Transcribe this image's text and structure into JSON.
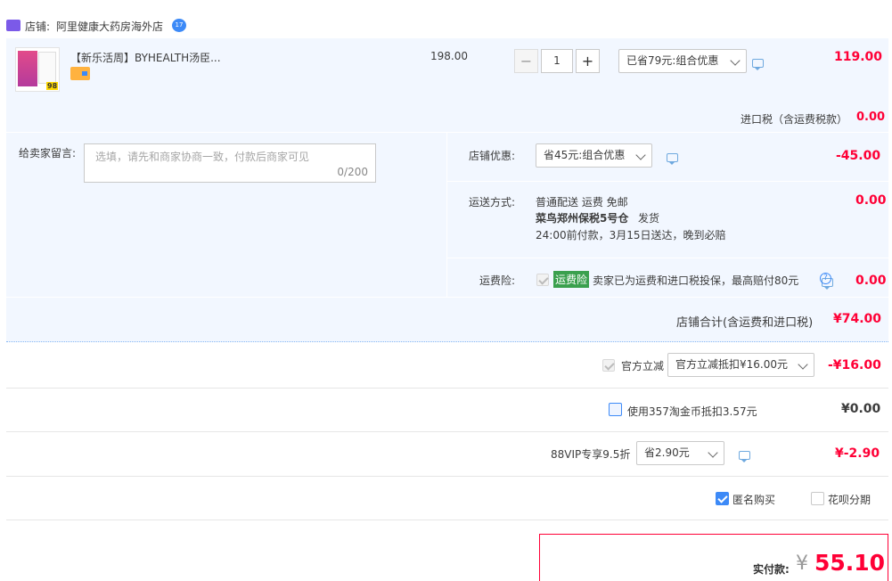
{
  "shop": {
    "label": "店铺:",
    "name": "阿里健康大药房海外店",
    "badge": "17"
  },
  "item": {
    "title": "【新乐活周】BYHEALTH汤臣...",
    "thumb_num": "98",
    "price": "198.00",
    "qty": "1",
    "minus": "−",
    "plus": "+",
    "promo": "已省79元:组合优惠",
    "total": "119.00"
  },
  "import_tax": {
    "label": "进口税（含运费税款）",
    "value": "0.00"
  },
  "message": {
    "label": "给卖家留言:",
    "placeholder": "选填，请先和商家协商一致，付款后商家可见",
    "count": "0/200"
  },
  "store_discount": {
    "label": "店铺优惠:",
    "option": "省45元:组合优惠",
    "value": "-45.00"
  },
  "shipping": {
    "label": "运送方式:",
    "line1": "普通配送 运费 免邮",
    "line2a": "菜鸟郑州保税5号仓",
    "line2b": "发货",
    "line3": "24:00前付款，3月15日送达，晚到必赔",
    "value": "0.00"
  },
  "insurance": {
    "label": "运费险:",
    "tag": "运费险",
    "desc": "卖家已为运费和进口税投保，最高赔付80元",
    "value": "0.00"
  },
  "store_total": {
    "label": "店铺合计(含运费和进口税)",
    "value": "¥74.00"
  },
  "official": {
    "label": "官方立减",
    "option": "官方立减抵扣¥16.00元",
    "value": "-¥16.00"
  },
  "coins": {
    "label": "使用357淘金币抵扣3.57元",
    "value": "¥0.00"
  },
  "vip": {
    "label": "88VIP专享9.5折",
    "option": "省2.90元",
    "value": "¥-2.90"
  },
  "options": {
    "anonymous": "匿名购买",
    "huabei": "花呗分期"
  },
  "payment": {
    "label": "实付款:",
    "currency": "¥",
    "amount": "55.10"
  },
  "colors": {
    "accent_red": "#ff0036",
    "panel_bg": "#f2f7ff",
    "blue": "#3d8af7",
    "green_tag": "#3aa04e"
  }
}
